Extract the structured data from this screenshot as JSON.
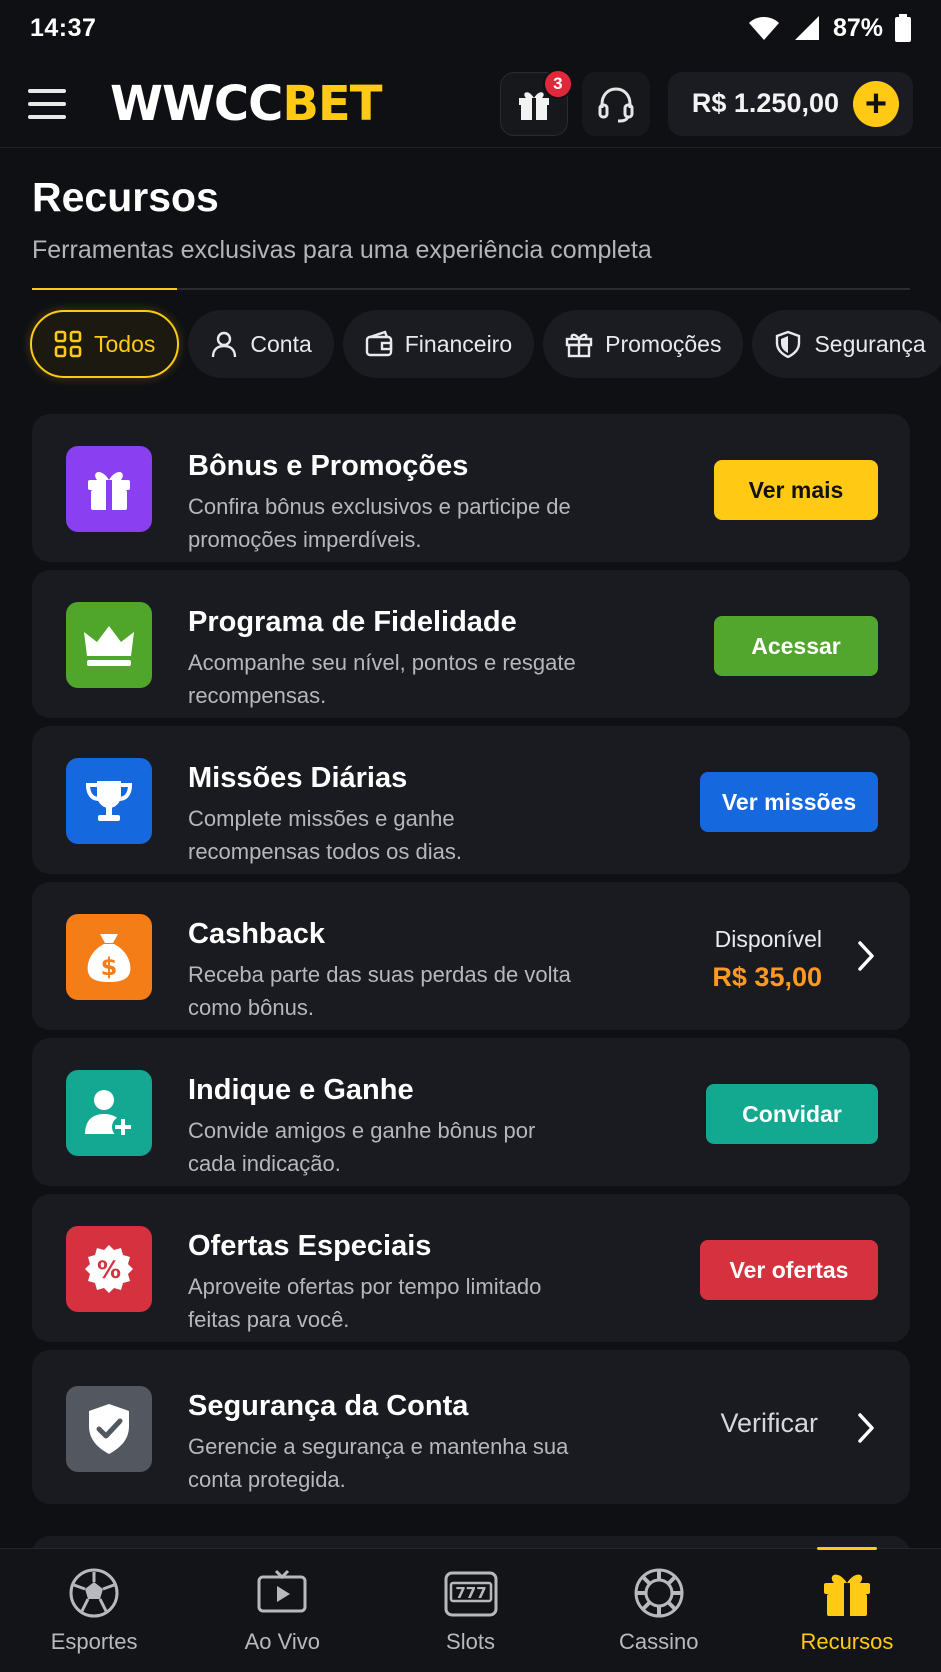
{
  "status": {
    "time": "14:37",
    "battery": "87%"
  },
  "header": {
    "logo_a": "WWCC",
    "logo_b": "BET",
    "gift_count": "3",
    "balance": "R$ 1.250,00",
    "add_symbol": "+"
  },
  "page": {
    "title": "Recursos",
    "subtitle": "Ferramentas exclusivas para uma experiência completa"
  },
  "tabs": [
    {
      "label": "Todos",
      "icon": "grid-icon",
      "active": true
    },
    {
      "label": "Conta",
      "icon": "user-icon"
    },
    {
      "label": "Financeiro",
      "icon": "wallet-icon"
    },
    {
      "label": "Promoções",
      "icon": "gift-icon"
    },
    {
      "label": "Segurança",
      "icon": "shield-icon"
    }
  ],
  "cards": [
    {
      "title": "Bônus e Promoções",
      "desc": "Confira bônus exclusivos e participe de promoções imperdíveis.",
      "button": "Ver mais",
      "icon": "gift-icon",
      "color": "#8a3ff0",
      "btn_color": "#ffc914",
      "btn_text_color": "#111111"
    },
    {
      "title": "Programa de Fidelidade",
      "desc": "Acompanhe seu nível, pontos e resgate recompensas.",
      "button": "Acessar",
      "icon": "crown-icon",
      "color": "#4fa62b",
      "btn_color": "#52a62e",
      "btn_text_color": "#ffffff"
    },
    {
      "title": "Missões Diárias",
      "desc": "Complete missões e ganhe recompensas todos os dias.",
      "button": "Ver missões",
      "icon": "trophy-icon",
      "color": "#1668de",
      "btn_color": "#1668de",
      "btn_text_color": "#ffffff"
    },
    {
      "title": "Cashback",
      "desc": "Receba parte das suas perdas de volta como bônus.",
      "available_label": "Disponível",
      "available_amount": "R$ 35,00",
      "icon": "money-bag-icon",
      "color": "#f57d18"
    },
    {
      "title": "Indique e Ganhe",
      "desc": "Convide amigos e ganhe bônus por cada indicação.",
      "button": "Convidar",
      "icon": "add-user-icon",
      "color": "#14a893",
      "btn_color": "#13a890",
      "btn_text_color": "#ffffff"
    },
    {
      "title": "Ofertas Especiais",
      "desc": "Aproveite ofertas por tempo limitado feitas para você.",
      "button": "Ver ofertas",
      "icon": "discount-icon",
      "color": "#d5313f",
      "btn_color": "#d5313f",
      "btn_text_color": "#ffffff"
    },
    {
      "title": "Segurança da Conta",
      "desc": "Gerencie a segurança e mantenha sua conta protegida.",
      "action": "Verificar",
      "icon": "shield-check-icon",
      "color": "#525760"
    }
  ],
  "nav": [
    {
      "label": "Esportes",
      "icon": "soccer-ball-icon"
    },
    {
      "label": "Ao Vivo",
      "icon": "live-play-icon"
    },
    {
      "label": "Slots",
      "icon": "slot-machine-icon"
    },
    {
      "label": "Cassino",
      "icon": "casino-chip-icon"
    },
    {
      "label": "Recursos",
      "icon": "gift-icon",
      "active": true
    }
  ]
}
